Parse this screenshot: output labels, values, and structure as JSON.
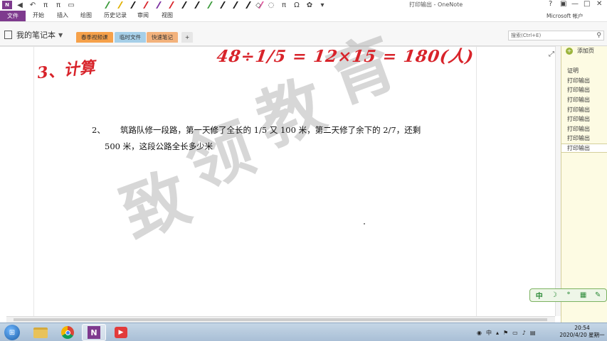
{
  "window": {
    "title": "打印输出 - OneNote",
    "help": "?",
    "controls": [
      "—",
      "□",
      "✕"
    ],
    "account": "Microsoft 帐户"
  },
  "ribbon": {
    "file": "文件",
    "tabs": [
      "开始",
      "插入",
      "绘图",
      "历史记录",
      "审阅",
      "视图"
    ]
  },
  "quick_access": {
    "pen_colors": [
      "#3a9a3a",
      "#e0b000",
      "#1a1a1a",
      "#d8232a",
      "#7a2ea0",
      "#d8232a",
      "#1a1a1a",
      "#1a1a1a",
      "#3a9a3a",
      "#1a1a1a",
      "#1a1a1a",
      "#1a1a1a",
      "#e05aa0"
    ],
    "pi": "π",
    "omega": "Ω"
  },
  "notebook": {
    "name": "我的笔记本",
    "sections": [
      {
        "label": "春季视频课",
        "color": "#f6a14a"
      },
      {
        "label": "临时文件",
        "color": "#a6cfe8"
      },
      {
        "label": "快速笔记",
        "color": "#f3b27c"
      }
    ],
    "add_section": "+",
    "search_placeholder": "搜索(Ctrl+E)"
  },
  "page": {
    "ink_top": "48÷1/5 = 12×15 = 180(人)",
    "ink_calc": "3、计算",
    "problem_number": "2、",
    "problem_line1": "筑路队修一段路，第一天修了全长的 1/5 又 100 米，第二天修了余下的 2/7，还剩",
    "problem_line2": "500 米，这段公路全长多少米",
    "watermark": "致领教育"
  },
  "pages_panel": {
    "add_page": "添加页",
    "items": [
      "证明",
      "打印输出",
      "打印输出",
      "打印输出",
      "打印输出",
      "打印输出",
      "打印输出",
      "打印输出",
      "打印输出"
    ],
    "active_index": 8
  },
  "ime_toolbar": {
    "buttons": [
      "中",
      "☽",
      "°",
      "▦",
      "✎"
    ]
  },
  "taskbar": {
    "tray_lang": "中",
    "clock_time": "20:54",
    "clock_date": "2020/4/20 星期一"
  }
}
